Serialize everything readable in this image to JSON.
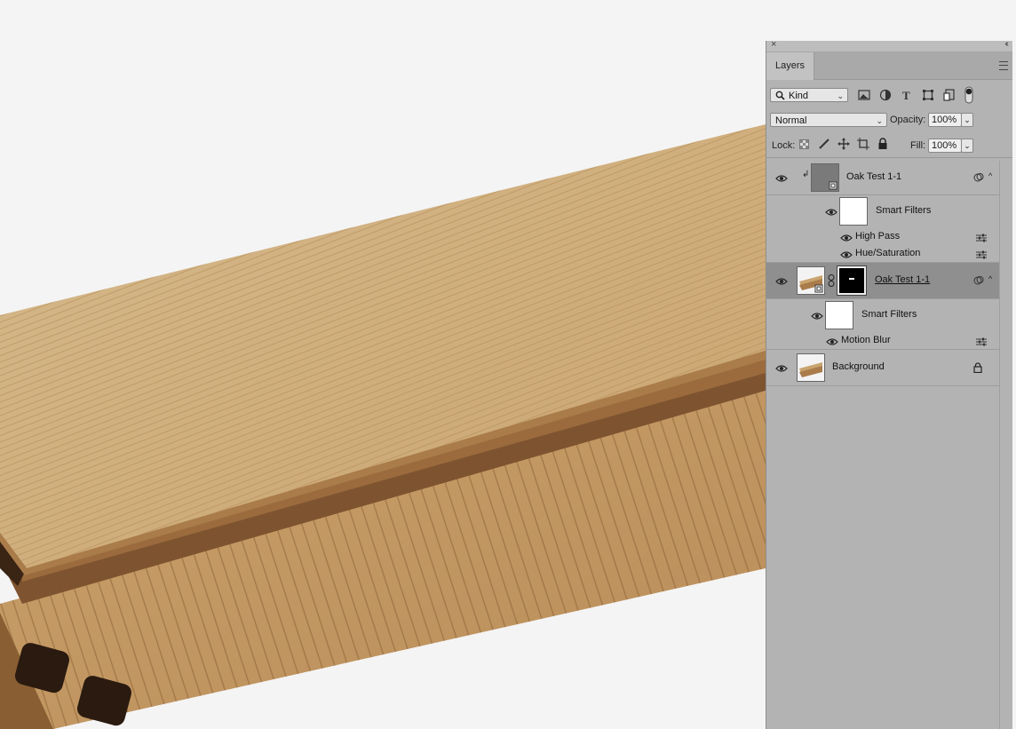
{
  "canvas": {
    "background": "#f4f4f5",
    "wood_light": "#d2b07e",
    "wood_dark": "#9a6a3d"
  },
  "panel": {
    "tab_label": "Layers",
    "filter": {
      "kind_label": "Kind"
    },
    "blend": {
      "mode": "Normal",
      "opacity_label": "Opacity:",
      "opacity_value": "100%"
    },
    "lock": {
      "label": "Lock:",
      "fill_label": "Fill:",
      "fill_value": "100%"
    },
    "layers": [
      {
        "name": "Oak Test 1-1",
        "type": "smart-object-clipped",
        "smart_filters_label": "Smart Filters",
        "filters": [
          "High Pass",
          "Hue/Saturation"
        ]
      },
      {
        "name": "Oak Test 1-1",
        "type": "smart-object-masked",
        "selected": true,
        "smart_filters_label": "Smart Filters",
        "filters": [
          "Motion Blur"
        ]
      },
      {
        "name": "Background",
        "type": "background-locked"
      }
    ]
  }
}
